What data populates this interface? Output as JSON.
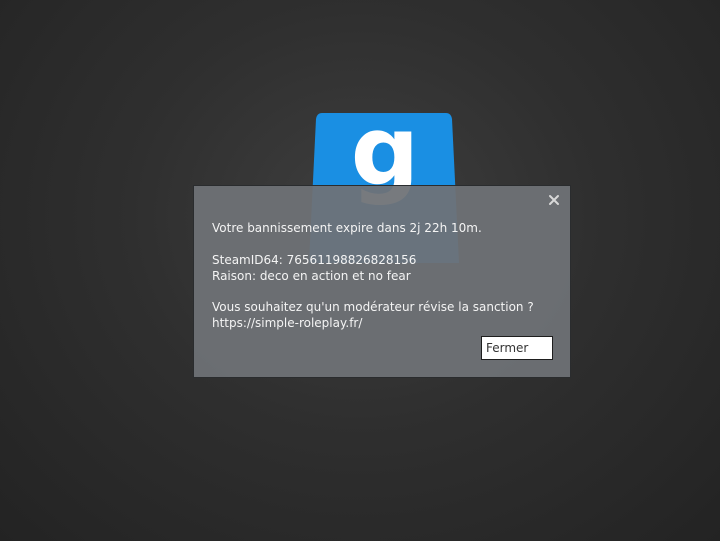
{
  "logo": {
    "icon": "garrysmod-logo-icon",
    "letter": "g",
    "color": "#1a8fe3"
  },
  "dialog": {
    "close_icon": "close-icon",
    "expiry_message": "Votre bannissement expire dans 2j 22h 10m.",
    "steamid_line": "SteamID64: 76561198826828156",
    "reason_line": "Raison: deco en action et no fear",
    "review_question": "Vous souhaitez qu'un modérateur révise la sanction ?",
    "review_url": "https://simple-roleplay.fr/",
    "close_button_label": "Fermer"
  }
}
